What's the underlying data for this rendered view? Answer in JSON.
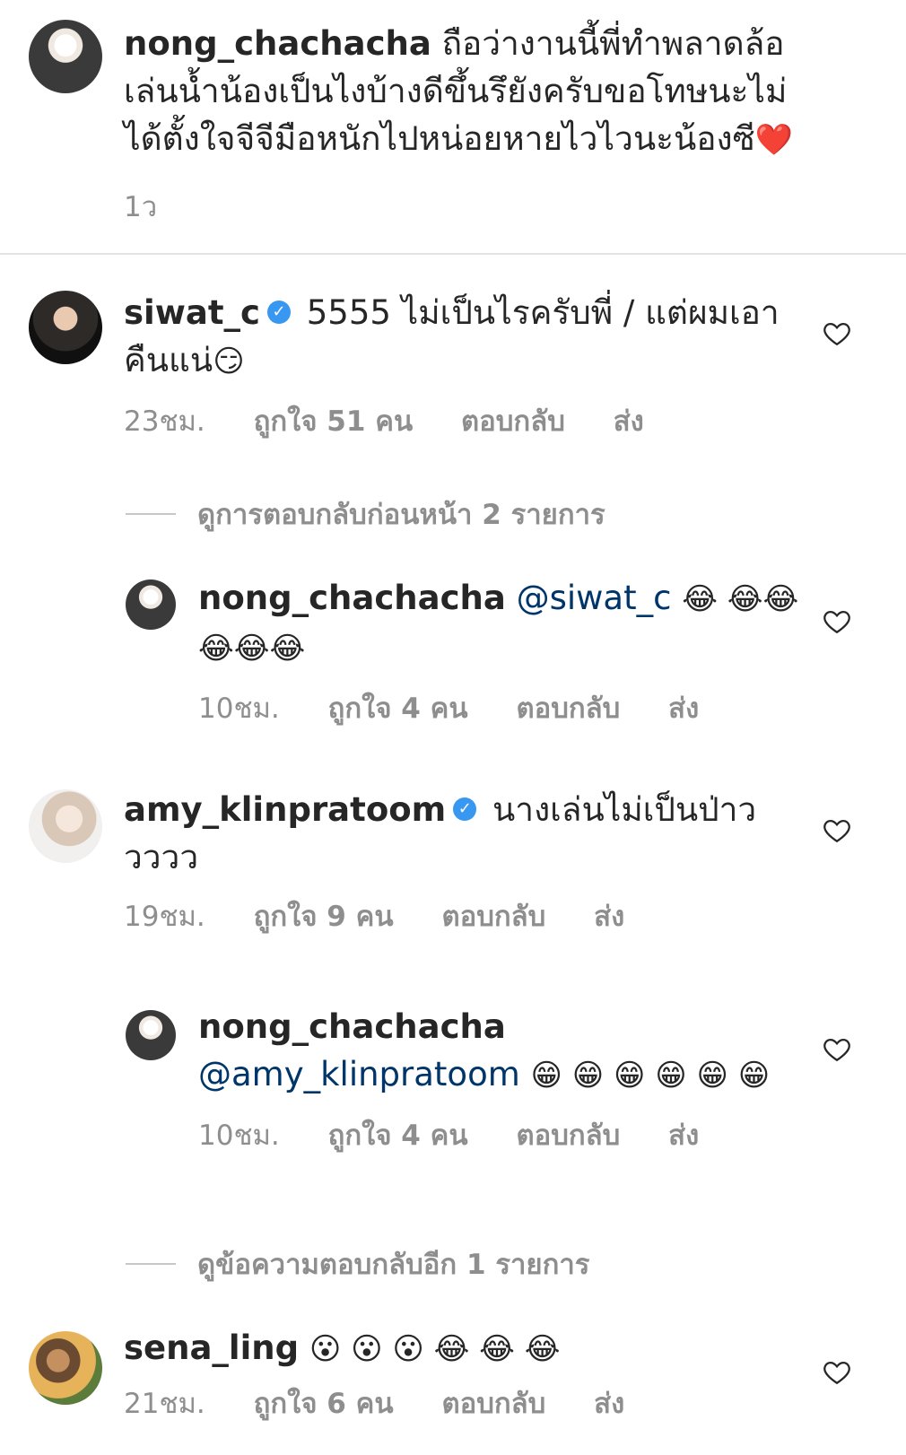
{
  "comments": [
    {
      "username": "nong_chachacha",
      "text": "ถือว่างานนี้พี่ทำพลาดล้อเล่นน้ำน้องเป็นไงบ้างดีขึ้นรึยังครับขอโทษนะไม่ได้ตั้งใจจีจีมือหนักไปหน่อยหายไวไวนะน้องซี",
      "emoji": "❤️",
      "time": "1ว"
    },
    {
      "username": "siwat_c",
      "verified_mark": "✓",
      "text": "5555 ไม่เป็นไรครับพี่ / แต่ผมเอาคืนแน่",
      "emoji": "😏",
      "time": "23ชม.",
      "likes": "ถูกใจ 51 คน",
      "reply": "ตอบกลับ",
      "send": "ส่ง"
    },
    {
      "username": "nong_chachacha",
      "mention": "@siwat_c",
      "emoji": "😂 😂😂😂😂😂",
      "time": "10ชม.",
      "likes": "ถูกใจ 4 คน",
      "reply": "ตอบกลับ",
      "send": "ส่ง"
    },
    {
      "username": "amy_klinpratoom",
      "verified_mark": "✓",
      "text": "นางเล่นไม่เป็นป่าววววว",
      "time": "19ชม.",
      "likes": "ถูกใจ 9 คน",
      "reply": "ตอบกลับ",
      "send": "ส่ง"
    },
    {
      "username": "nong_chachacha",
      "mention": "@amy_klinpratoom",
      "emoji": "😁 😁 😁 😁 😁 😁",
      "time": "10ชม.",
      "likes": "ถูกใจ 4 คน",
      "reply": "ตอบกลับ",
      "send": "ส่ง"
    },
    {
      "username": "sena_ling",
      "emoji": "😮 😮 😮 😂 😂 😂",
      "time": "21ชม.",
      "likes": "ถูกใจ 6 คน",
      "reply": "ตอบกลับ",
      "send": "ส่ง"
    }
  ],
  "view_previous_replies": "ดูการตอบกลับก่อนหน้า 2 รายการ",
  "view_more_replies": "ดูข้อความตอบกลับอีก 1 รายการ",
  "icons": {
    "like": "heart-outline-icon"
  }
}
